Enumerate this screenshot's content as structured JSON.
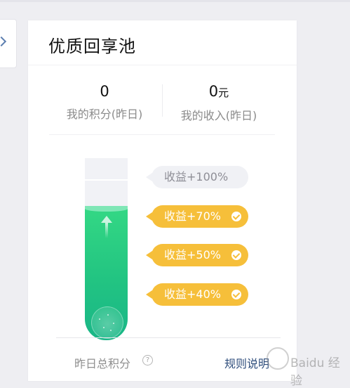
{
  "card": {
    "title": "优质回享池"
  },
  "stats": {
    "points": {
      "value": "0",
      "label": "我的积分(昨日)"
    },
    "income": {
      "value": "0",
      "unit": "元",
      "label": "我的收入(昨日)"
    }
  },
  "tube": {
    "fill_level_percent": 72,
    "fill_color": "#22c482"
  },
  "tags": [
    {
      "label": "收益+100%",
      "achieved": false,
      "bg": "#f0f1f5",
      "color": "#8e8e96"
    },
    {
      "label": "收益+70%",
      "achieved": true,
      "bg": "#f6bf3a",
      "color": "#ffffff"
    },
    {
      "label": "收益+50%",
      "achieved": true,
      "bg": "#f6bf3a",
      "color": "#ffffff"
    },
    {
      "label": "收益+40%",
      "achieved": true,
      "bg": "#f6bf3a",
      "color": "#ffffff"
    }
  ],
  "footer": {
    "total_label": "昨日总积分",
    "help_icon": "question-circle-icon",
    "help_glyph": "?",
    "rules_link": "规则说明"
  },
  "colors": {
    "accent_gold": "#f6bf3a",
    "accent_green": "#22c482",
    "link": "#2f4e7c"
  },
  "watermark": {
    "text": "Baidu 经验"
  }
}
